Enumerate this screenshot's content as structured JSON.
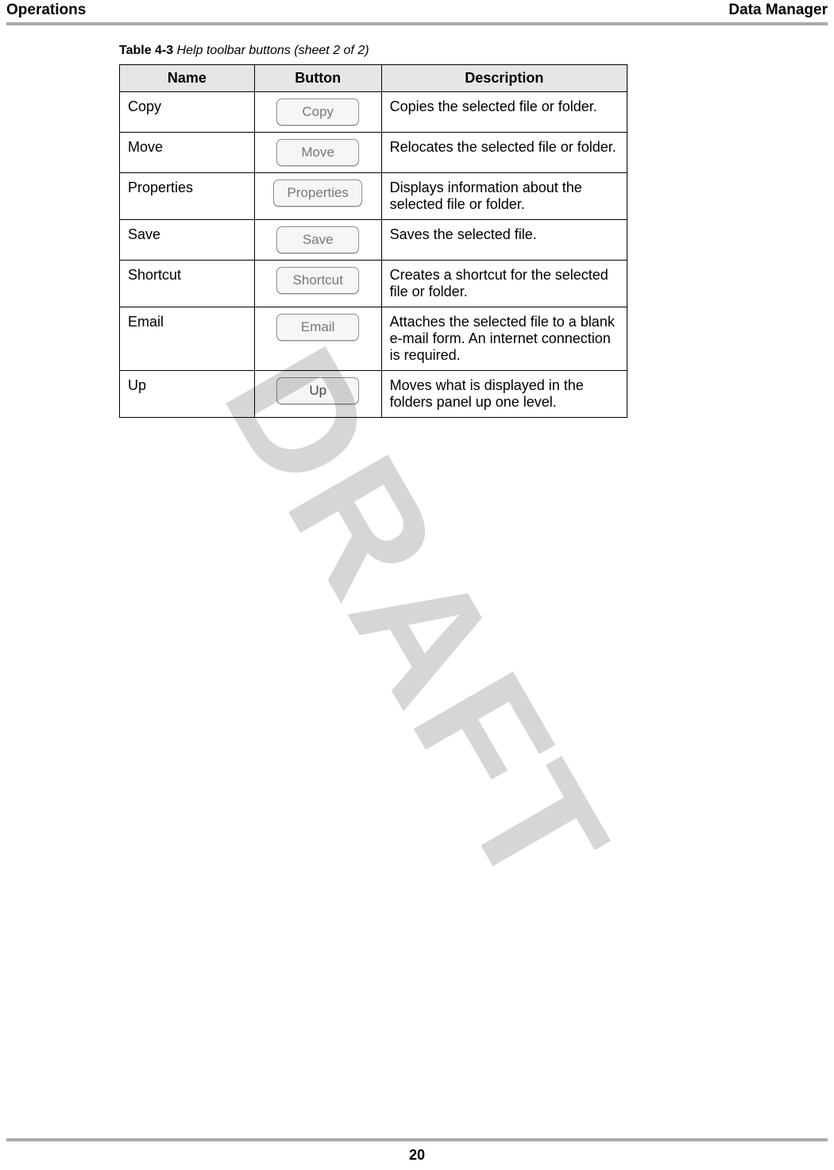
{
  "header": {
    "left": "Operations",
    "right": "Data Manager"
  },
  "caption": {
    "label": "Table 4-3",
    "title": "Help toolbar buttons (sheet 2 of 2)"
  },
  "columns": {
    "name": "Name",
    "button": "Button",
    "description": "Description"
  },
  "rows": [
    {
      "name": "Copy",
      "button_label": "Copy",
      "description": "Copies the selected file or folder."
    },
    {
      "name": "Move",
      "button_label": "Move",
      "description": "Relocates the selected file or folder."
    },
    {
      "name": "Properties",
      "button_label": "Properties",
      "description": "Displays information about the selected file or folder."
    },
    {
      "name": "Save",
      "button_label": "Save",
      "description": "Saves the selected file."
    },
    {
      "name": "Shortcut",
      "button_label": "Shortcut",
      "description": "Creates a shortcut for the selected file or folder."
    },
    {
      "name": "Email",
      "button_label": "Email",
      "description": "Attaches the selected file to a blank e-mail form. An internet connection is required."
    },
    {
      "name": "Up",
      "button_label": "Up",
      "description": "Moves what is displayed in the folders panel up one level."
    }
  ],
  "watermark": "DRAFT",
  "page_number": "20"
}
